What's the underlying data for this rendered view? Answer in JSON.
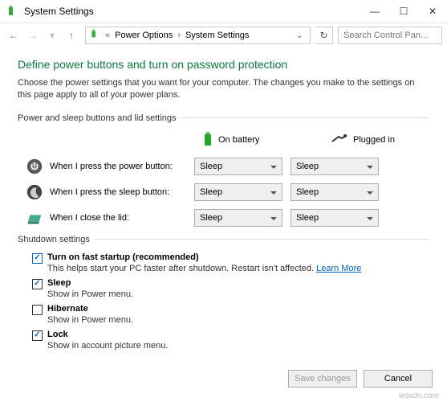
{
  "window": {
    "title": "System Settings",
    "minimize": "—",
    "maximize": "☐",
    "close": "✕"
  },
  "nav": {
    "back": "←",
    "forward": "→",
    "recent": "▾",
    "up": "↑",
    "crumb1": "Power Options",
    "crumb2": "System Settings",
    "search_placeholder": "Search Control Pan..."
  },
  "page": {
    "heading": "Define power buttons and turn on password protection",
    "description": "Choose the power settings that you want for your computer. The changes you make to the settings on this page apply to all of your power plans.",
    "group1_label": "Power and sleep buttons and lid settings",
    "col_battery": "On battery",
    "col_plugged": "Plugged in",
    "row_power_label": "When I press the power button:",
    "row_sleep_label": "When I press the sleep button:",
    "row_lid_label": "When I close the lid:",
    "sel_value": "Sleep",
    "group2_label": "Shutdown settings",
    "fast_title": "Turn on fast startup (recommended)",
    "fast_desc_a": "This helps start your PC faster after shutdown. Restart isn't affected. ",
    "fast_learn": "Learn More",
    "sleep_title": "Sleep",
    "sleep_desc": "Show in Power menu.",
    "hibernate_title": "Hibernate",
    "hibernate_desc": "Show in Power menu.",
    "lock_title": "Lock",
    "lock_desc": "Show in account picture menu."
  },
  "footer": {
    "save": "Save changes",
    "cancel": "Cancel"
  },
  "watermark": "wsxdn.com"
}
